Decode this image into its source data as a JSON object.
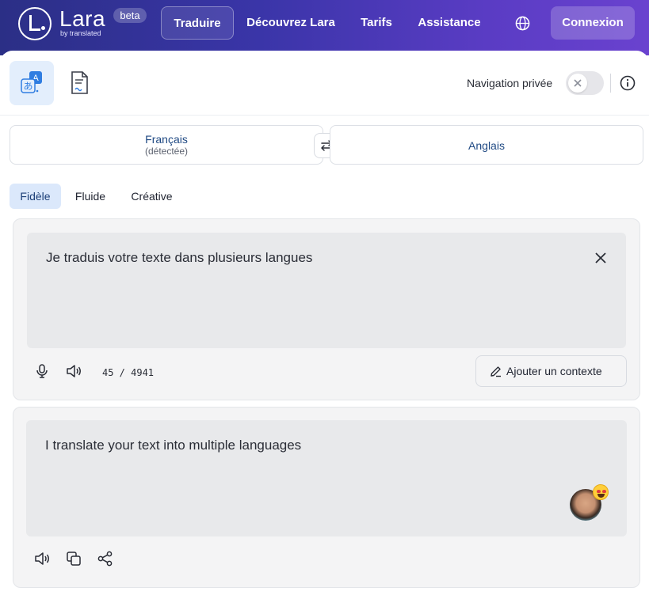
{
  "header": {
    "brand": "Lara",
    "brand_sub": "by translated",
    "badge": "beta",
    "nav": [
      "Traduire",
      "Découvrez Lara",
      "Tarifs",
      "Assistance"
    ],
    "login": "Connexion",
    "colors": {
      "gradient_start": "#2b2f86",
      "gradient_end": "#6a42cf"
    }
  },
  "toolbar": {
    "modes": [
      "translate-text-icon",
      "translate-document-icon"
    ],
    "private_label": "Navigation privée",
    "private_enabled": false
  },
  "languages": {
    "source": "Français",
    "source_detected": "(détectée)",
    "target": "Anglais"
  },
  "styles": {
    "tabs": [
      "Fidèle",
      "Fluide",
      "Créative"
    ],
    "selected": "Fidèle"
  },
  "source": {
    "text": "Je traduis votre texte dans plusieurs langues",
    "counter": "45 / 4941",
    "context_button": "Ajouter un contexte"
  },
  "target": {
    "text": "I translate your text into multiple languages"
  }
}
